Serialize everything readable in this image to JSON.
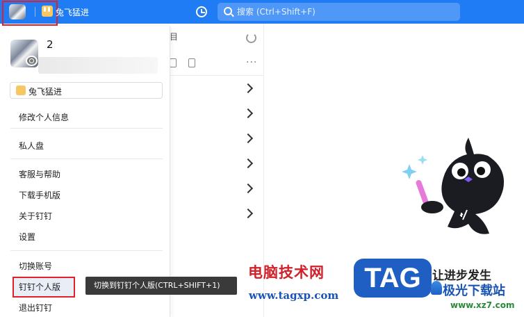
{
  "topbar": {
    "org_name": "兔飞猛进",
    "search": {
      "placeholder": "搜索 (Ctrl+Shift+F)",
      "value": ""
    }
  },
  "middle": {
    "header_fragment": "目"
  },
  "menu": {
    "profile_name": "2",
    "org_card_label": "兔飞猛进",
    "items": [
      {
        "label": "修改个人信息"
      },
      {
        "label": "私人盘"
      },
      {
        "label": "客服与帮助"
      },
      {
        "label": "下载手机版"
      },
      {
        "label": "关于钉钉"
      },
      {
        "label": "设置"
      },
      {
        "label": "切换账号"
      },
      {
        "label": "钉钉个人版"
      },
      {
        "label": "退出钉钉"
      }
    ],
    "tooltip": "切换到钉钉个人版(CTRL+SHIFT+1)"
  },
  "watermark": {
    "cn_text": "电脑技术网",
    "url": "www.tagxp.com",
    "tag": "TAG",
    "slogan": "让进步发生",
    "site": "极光下载站",
    "site_url": "www.xz7.com"
  },
  "colors": {
    "topbar": "#1f7cf5",
    "highlight": "#e0202a",
    "tooltip_bg": "#3a3a3a"
  }
}
